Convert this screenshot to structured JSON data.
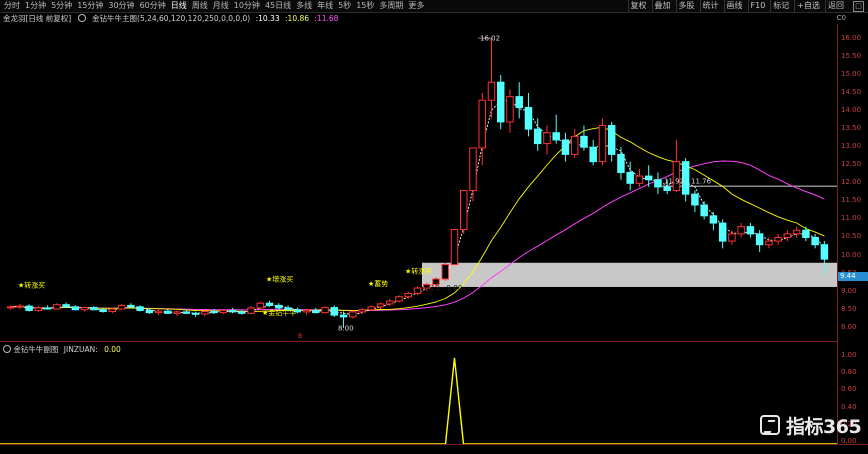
{
  "toolbar": {
    "timeframes": [
      "分时",
      "1分钟",
      "5分钟",
      "15分钟",
      "30分钟",
      "60分钟",
      "日线",
      "周线",
      "月线",
      "10分钟",
      "45日线",
      "多线",
      "年线",
      "5秒",
      "15秒",
      "多周期",
      "更多"
    ],
    "active_timeframe": "日线",
    "right_buttons": [
      "复权",
      "叠加",
      "多股",
      "统计",
      "画线",
      "F10",
      "标记",
      "+自选",
      "返回"
    ]
  },
  "info": {
    "stock_label": "金龙羽[日线 前复权]",
    "indicator_name": "金钻牛牛主图(5,24,60,120,120,250,0,0,0,0)",
    "v1": ":10.33",
    "v2": ":10.86",
    "v3": ":11.68",
    "right_label": "C0"
  },
  "axis": {
    "ticks": [
      "16.00",
      "15.50",
      "15.00",
      "14.50",
      "14.00",
      "13.50",
      "13.00",
      "12.50",
      "12.00",
      "11.50",
      "11.00",
      "10.50",
      "10.00",
      "9.50",
      "9.00",
      "8.50",
      "8.00"
    ],
    "current_price": "9.44",
    "sub_ticks": [
      "1.00",
      "0.80",
      "0.60",
      "0.40",
      "0.20",
      "0.00"
    ]
  },
  "annotations": {
    "high": "16.02",
    "low": "8.00",
    "level_box": "11.92 - 11.76",
    "zone_box": "9.13 - 9.80",
    "signal_left": "★转涨买",
    "signal_mid": "★增涨买",
    "signal_right_1": "★蓄势",
    "signal_right_2": "★转涨买",
    "signal_bottom": "★金钻牛牛",
    "marker_red": "B"
  },
  "sub": {
    "name": "金钻牛牛副图",
    "series": "JINZUAN:",
    "value": "0.00"
  },
  "watermark": "指标365",
  "colors": {
    "up": "#ff3232",
    "down": "#54ffff",
    "ma_white": "#ffffff",
    "ma_yellow": "#ffff00",
    "ma_magenta": "#ff40ff",
    "zone": "#c8c8c8",
    "axis": "#c84040",
    "signal": "#ffff00"
  },
  "chart_data": {
    "type": "candlestick",
    "ylim": [
      7.8,
      16.3
    ],
    "ohlc": [
      [
        8.55,
        8.62,
        8.5,
        8.58
      ],
      [
        8.58,
        8.66,
        8.52,
        8.6
      ],
      [
        8.6,
        8.65,
        8.45,
        8.48
      ],
      [
        8.48,
        8.6,
        8.44,
        8.55
      ],
      [
        8.55,
        8.62,
        8.5,
        8.52
      ],
      [
        8.52,
        8.68,
        8.5,
        8.64
      ],
      [
        8.64,
        8.7,
        8.55,
        8.58
      ],
      [
        8.58,
        8.62,
        8.48,
        8.5
      ],
      [
        8.5,
        8.58,
        8.45,
        8.56
      ],
      [
        8.56,
        8.6,
        8.48,
        8.5
      ],
      [
        8.5,
        8.56,
        8.42,
        8.45
      ],
      [
        8.45,
        8.55,
        8.4,
        8.52
      ],
      [
        8.52,
        8.66,
        8.5,
        8.62
      ],
      [
        8.62,
        8.68,
        8.55,
        8.58
      ],
      [
        8.58,
        8.62,
        8.45,
        8.48
      ],
      [
        8.48,
        8.55,
        8.38,
        8.42
      ],
      [
        8.42,
        8.5,
        8.35,
        8.46
      ],
      [
        8.46,
        8.52,
        8.38,
        8.4
      ],
      [
        8.4,
        8.48,
        8.32,
        8.44
      ],
      [
        8.44,
        8.5,
        8.38,
        8.4
      ],
      [
        8.4,
        8.45,
        8.3,
        8.38
      ],
      [
        8.38,
        8.48,
        8.32,
        8.45
      ],
      [
        8.45,
        8.52,
        8.38,
        8.42
      ],
      [
        8.42,
        8.5,
        8.38,
        8.48
      ],
      [
        8.48,
        8.55,
        8.4,
        8.44
      ],
      [
        8.44,
        8.5,
        8.36,
        8.4
      ],
      [
        8.4,
        8.6,
        8.38,
        8.55
      ],
      [
        8.55,
        8.72,
        8.5,
        8.68
      ],
      [
        8.68,
        8.75,
        8.58,
        8.62
      ],
      [
        8.62,
        8.68,
        8.5,
        8.55
      ],
      [
        8.55,
        8.62,
        8.45,
        8.5
      ],
      [
        8.5,
        8.56,
        8.4,
        8.44
      ],
      [
        8.44,
        8.52,
        8.36,
        8.48
      ],
      [
        8.48,
        8.55,
        8.4,
        8.42
      ],
      [
        8.42,
        8.6,
        8.4,
        8.56
      ],
      [
        8.56,
        8.62,
        8.3,
        8.35
      ],
      [
        8.35,
        8.45,
        8.0,
        8.3
      ],
      [
        8.3,
        8.48,
        8.26,
        8.44
      ],
      [
        8.44,
        8.55,
        8.38,
        8.5
      ],
      [
        8.5,
        8.62,
        8.46,
        8.58
      ],
      [
        8.58,
        8.7,
        8.52,
        8.66
      ],
      [
        8.66,
        8.8,
        8.6,
        8.74
      ],
      [
        8.74,
        8.9,
        8.7,
        8.86
      ],
      [
        8.86,
        9.0,
        8.8,
        8.95
      ],
      [
        8.95,
        9.15,
        8.9,
        9.1
      ],
      [
        9.1,
        9.25,
        9.02,
        9.2
      ],
      [
        9.2,
        9.4,
        9.13,
        9.35
      ],
      [
        9.35,
        9.8,
        9.3,
        9.75
      ],
      [
        9.75,
        10.72,
        9.75,
        10.72
      ],
      [
        10.72,
        11.8,
        10.6,
        11.8
      ],
      [
        11.8,
        12.98,
        11.5,
        12.98
      ],
      [
        12.98,
        14.5,
        12.5,
        14.3
      ],
      [
        14.3,
        16.02,
        13.8,
        14.8
      ],
      [
        14.8,
        15.0,
        13.5,
        13.7
      ],
      [
        13.7,
        14.6,
        13.4,
        14.4
      ],
      [
        14.4,
        14.8,
        13.8,
        14.1
      ],
      [
        14.1,
        14.5,
        13.3,
        13.5
      ],
      [
        13.5,
        13.8,
        12.9,
        13.1
      ],
      [
        13.1,
        13.6,
        12.8,
        13.4
      ],
      [
        13.4,
        13.9,
        13.1,
        13.2
      ],
      [
        13.2,
        13.4,
        12.6,
        12.8
      ],
      [
        12.8,
        13.5,
        12.7,
        13.3
      ],
      [
        13.3,
        13.6,
        12.9,
        13.0
      ],
      [
        13.0,
        13.2,
        12.5,
        12.6
      ],
      [
        12.6,
        13.8,
        12.5,
        13.6
      ],
      [
        13.6,
        13.7,
        12.6,
        12.8
      ],
      [
        12.8,
        13.0,
        12.1,
        12.3
      ],
      [
        12.3,
        12.6,
        11.8,
        12.0
      ],
      [
        12.0,
        12.4,
        11.9,
        12.2
      ],
      [
        12.2,
        12.5,
        11.9,
        12.1
      ],
      [
        12.1,
        12.3,
        11.7,
        11.9
      ],
      [
        11.9,
        12.1,
        11.7,
        11.8
      ],
      [
        11.8,
        13.2,
        11.76,
        12.6
      ],
      [
        12.6,
        12.7,
        11.5,
        11.7
      ],
      [
        11.7,
        11.8,
        11.2,
        11.4
      ],
      [
        11.4,
        11.5,
        11.0,
        11.1
      ],
      [
        11.1,
        11.2,
        10.7,
        10.9
      ],
      [
        10.9,
        11.0,
        10.2,
        10.4
      ],
      [
        10.4,
        10.7,
        10.3,
        10.6
      ],
      [
        10.6,
        10.9,
        10.5,
        10.8
      ],
      [
        10.8,
        10.9,
        10.5,
        10.6
      ],
      [
        10.6,
        10.7,
        10.1,
        10.3
      ],
      [
        10.3,
        10.5,
        10.2,
        10.4
      ],
      [
        10.4,
        10.6,
        10.3,
        10.5
      ],
      [
        10.5,
        10.7,
        10.4,
        10.6
      ],
      [
        10.6,
        10.8,
        10.5,
        10.7
      ],
      [
        10.7,
        10.8,
        10.4,
        10.5
      ],
      [
        10.5,
        10.6,
        10.2,
        10.3
      ],
      [
        10.3,
        10.4,
        9.44,
        9.9
      ]
    ],
    "sub_spike_index": 20
  }
}
